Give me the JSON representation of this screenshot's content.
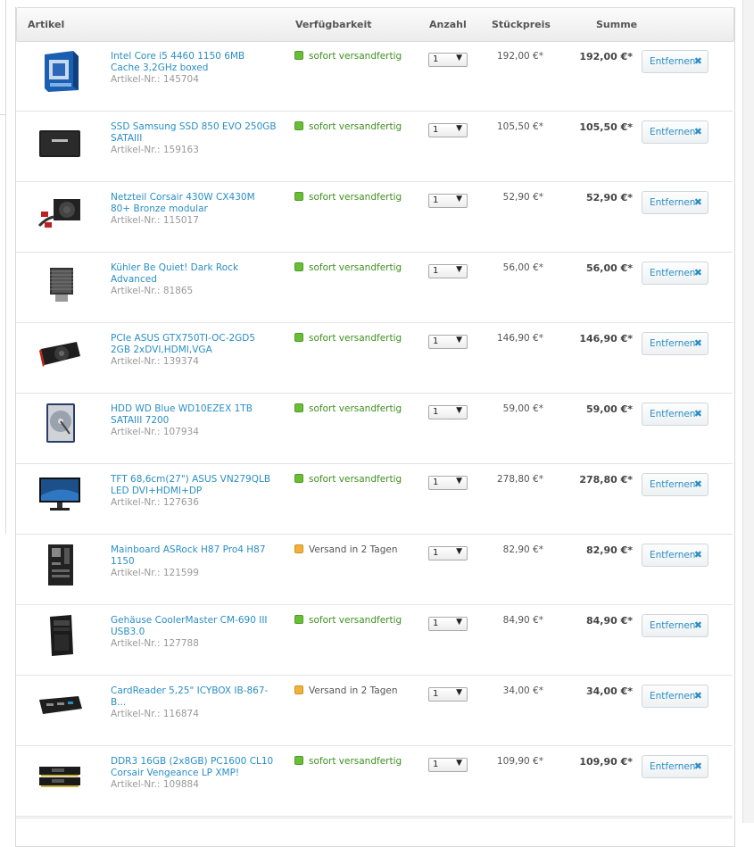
{
  "header": {
    "artikel": "Artikel",
    "verfuegbarkeit": "Verfügbarkeit",
    "anzahl": "Anzahl",
    "stueckpreis": "Stückpreis",
    "summe": "Summe"
  },
  "colors": {
    "link": "#2a8ec4",
    "in_stock": "#6abe36",
    "delayed": "#f0b23a"
  },
  "items": [
    {
      "name": "Intel Core i5 4460 1150 6MB Cache 3,2GHz boxed",
      "artnr": "Artikel-Nr.: 145704",
      "availability": "sofort versandfertig",
      "status": "green",
      "qty": "1",
      "unit": "192,00 €*",
      "sum": "192,00 €*",
      "remove": "Entfernen",
      "icon": "cpu-box-icon"
    },
    {
      "name": "SSD Samsung SSD 850 EVO 250GB SATAIII",
      "artnr": "Artikel-Nr.: 159163",
      "availability": "sofort versandfertig",
      "status": "green",
      "qty": "1",
      "unit": "105,50 €*",
      "sum": "105,50 €*",
      "remove": "Entfernen",
      "icon": "ssd-icon"
    },
    {
      "name": "Netzteil Corsair 430W CX430M 80+ Bronze modular",
      "artnr": "Artikel-Nr.: 115017",
      "availability": "sofort versandfertig",
      "status": "green",
      "qty": "1",
      "unit": "52,90 €*",
      "sum": "52,90 €*",
      "remove": "Entfernen",
      "icon": "psu-icon"
    },
    {
      "name": "Kühler Be Quiet! Dark Rock Advanced",
      "artnr": "Artikel-Nr.: 81865",
      "availability": "sofort versandfertig",
      "status": "green",
      "qty": "1",
      "unit": "56,00 €*",
      "sum": "56,00 €*",
      "remove": "Entfernen",
      "icon": "cpu-cooler-icon"
    },
    {
      "name": "PCIe ASUS GTX750TI-OC-2GD5 2GB 2xDVI,HDMI,VGA",
      "artnr": "Artikel-Nr.: 139374",
      "availability": "sofort versandfertig",
      "status": "green",
      "qty": "1",
      "unit": "146,90 €*",
      "sum": "146,90 €*",
      "remove": "Entfernen",
      "icon": "graphics-card-icon"
    },
    {
      "name": "HDD WD Blue WD10EZEX 1TB SATAIII 7200",
      "artnr": "Artikel-Nr.: 107934",
      "availability": "sofort versandfertig",
      "status": "green",
      "qty": "1",
      "unit": "59,00 €*",
      "sum": "59,00 €*",
      "remove": "Entfernen",
      "icon": "hard-drive-icon"
    },
    {
      "name": "TFT 68,6cm(27\") ASUS VN279QLB LED DVI+HDMI+DP",
      "artnr": "Artikel-Nr.: 127636",
      "availability": "sofort versandfertig",
      "status": "green",
      "qty": "1",
      "unit": "278,80 €*",
      "sum": "278,80 €*",
      "remove": "Entfernen",
      "icon": "monitor-icon"
    },
    {
      "name": "Mainboard ASRock H87 Pro4 H87 1150",
      "artnr": "Artikel-Nr.: 121599",
      "availability": "Versand in 2 Tagen",
      "status": "orange",
      "qty": "1",
      "unit": "82,90 €*",
      "sum": "82,90 €*",
      "remove": "Entfernen",
      "icon": "mainboard-icon"
    },
    {
      "name": "Gehäuse CoolerMaster CM-690 III USB3.0",
      "artnr": "Artikel-Nr.: 127788",
      "availability": "sofort versandfertig",
      "status": "green",
      "qty": "1",
      "unit": "84,90 €*",
      "sum": "84,90 €*",
      "remove": "Entfernen",
      "icon": "pc-case-icon"
    },
    {
      "name": "CardReader 5,25\" ICYBOX IB-867-B...",
      "artnr": "Artikel-Nr.: 116874",
      "availability": "Versand in 2 Tagen",
      "status": "orange",
      "qty": "1",
      "unit": "34,00 €*",
      "sum": "34,00 €*",
      "remove": "Entfernen",
      "icon": "card-reader-icon"
    },
    {
      "name": "DDR3 16GB (2x8GB) PC1600 CL10 Corsair Vengeance LP XMP!",
      "artnr": "Artikel-Nr.: 109884",
      "availability": "sofort versandfertig",
      "status": "green",
      "qty": "1",
      "unit": "109,90 €*",
      "sum": "109,90 €*",
      "remove": "Entfernen",
      "icon": "ram-icon"
    }
  ]
}
